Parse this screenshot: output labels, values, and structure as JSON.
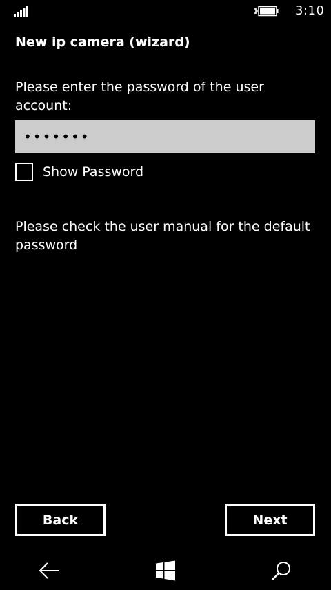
{
  "status_bar": {
    "time": "3:10",
    "signal_icon": "signal-bars-icon",
    "battery_icon": "battery-charging-icon"
  },
  "page": {
    "title": "New ip camera (wizard)",
    "prompt": "Please enter the password of the user account:",
    "password_value": "•••••••",
    "show_password_label": "Show Password",
    "show_password_checked": false,
    "hint": "Please check the user manual for the default password"
  },
  "buttons": {
    "back_label": "Back",
    "next_label": "Next"
  },
  "nav_bar": {
    "back_icon": "arrow-left-icon",
    "home_icon": "windows-logo-icon",
    "search_icon": "search-icon"
  },
  "colors": {
    "background": "#000000",
    "text": "#ffffff",
    "input_background": "#cccccc"
  }
}
